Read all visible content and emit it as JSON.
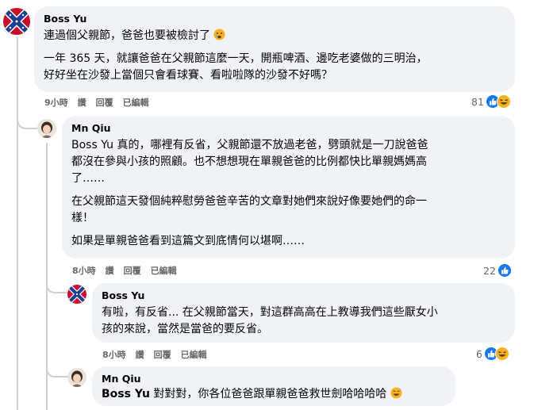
{
  "comments": [
    {
      "author": "Boss Yu",
      "paragraphs": [
        "連過個父親節，爸爸也要被檢討了",
        "一年 365 天，就讓爸爸在父親節這麼一天，開瓶啤酒、邊吃老婆做的三明治，",
        "好好坐在沙發上當個只會看球賽、看啦啦隊的沙發不好嗎？"
      ],
      "emoji_in_text": "crying-face",
      "time": "9小時",
      "actions": [
        "讚",
        "回覆",
        "已編輯"
      ],
      "reaction_count": "81",
      "reaction_icons": [
        "like-icon",
        "haha-icon"
      ]
    },
    {
      "author": "Mn Qiu",
      "mention": "Boss Yu",
      "lines": [
        " 真的，哪裡有反省，父親節還不放過老爸，劈頭就是一刀說爸爸",
        "都沒在參與小孩的照顧。也不想想現在單親爸爸的比例都快比單親媽媽高",
        "了……",
        "在父親節這天發個純粹慰勞爸爸辛苦的文章對她們來說好像要她們的命一",
        "樣！",
        "如果是單親爸爸看到這篇文到底情何以堪啊……"
      ],
      "time": "8小時",
      "actions": [
        "讚",
        "回覆",
        "已編輯"
      ],
      "reaction_count": "22",
      "reaction_icons": [
        "like-icon"
      ]
    },
    {
      "author": "Boss Yu",
      "lines": [
        "有啦，有反省... 在父親節當天，對這群高高在上教導我們這些厭女小",
        "孩的來說，當然是當爸的要反省。"
      ],
      "time": "8小時",
      "actions": [
        "讚",
        "回覆",
        "已編輯"
      ],
      "reaction_count": "6",
      "reaction_icons": [
        "like-icon",
        "haha-icon"
      ]
    },
    {
      "author": "Mn Qiu",
      "mention": "Boss Yu",
      "text": " 對對對，你各位爸爸跟單親爸爸救世劍哈哈哈哈",
      "emoji_in_text": "grinning-sweat-face"
    }
  ],
  "colors": {
    "bubble": "#f0f2f5",
    "meta": "#65676b",
    "like_blue": "#1877f2",
    "haha_yellow": "#f7b125",
    "thread_line": "#ced0d4"
  }
}
